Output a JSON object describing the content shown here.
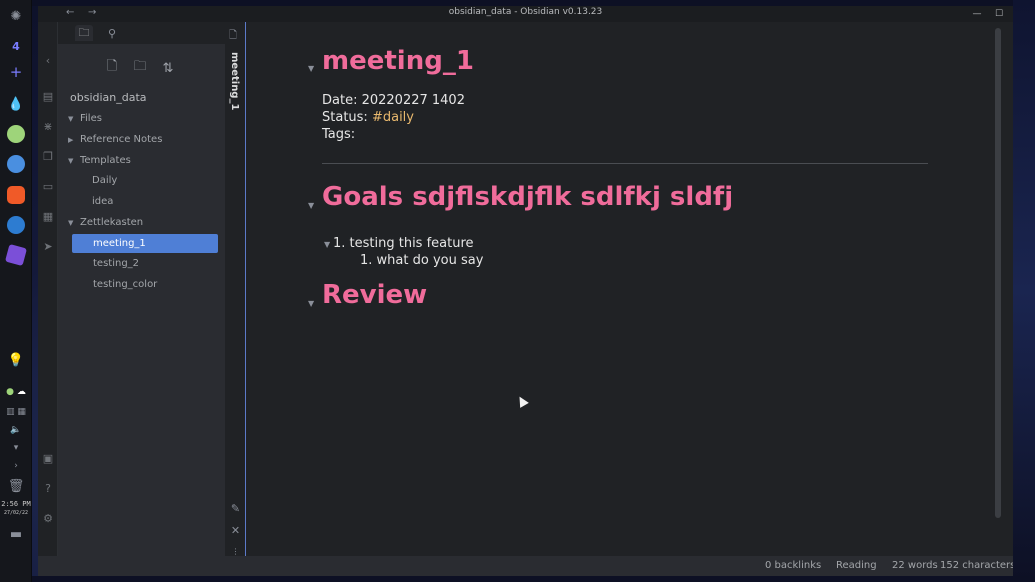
{
  "window": {
    "title": "obsidian_data - Obsidian v0.13.23",
    "back": "←",
    "forward": "→",
    "minimize": "—",
    "maximize": "☐",
    "close": "✕"
  },
  "os_panel": {
    "workspace": "4",
    "add": "+",
    "clock_time": "2:56 PM",
    "clock_date": "27/02/22"
  },
  "explorer": {
    "vault_name": "obsidian_data",
    "tree": [
      {
        "label": "Files",
        "caret": "▼",
        "level": 0
      },
      {
        "label": "Reference Notes",
        "caret": "▶",
        "level": 0
      },
      {
        "label": "Templates",
        "caret": "▼",
        "level": 0
      },
      {
        "label": "Daily",
        "caret": "",
        "level": 1
      },
      {
        "label": "idea",
        "caret": "",
        "level": 1
      },
      {
        "label": "Zettlekasten",
        "caret": "▼",
        "level": 0
      },
      {
        "label": "meeting_1",
        "caret": "",
        "level": 1,
        "selected": true
      },
      {
        "label": "testing_2",
        "caret": "",
        "level": 1
      },
      {
        "label": "testing_color",
        "caret": "",
        "level": 1
      }
    ]
  },
  "tab": {
    "label": "meeting_1"
  },
  "note": {
    "heading1": "meeting_1",
    "date": "Date: 20220227 1402",
    "status_label": "Status:",
    "status_tag": "#daily",
    "tags_label": "Tags:",
    "heading2": "Goals sdjflskdjflk sdlfkj sldfj",
    "list_item_1": "1. testing this feature",
    "list_item_2": "1. what do you say",
    "heading3": "Review"
  },
  "statusbar": {
    "backlinks": "0 backlinks",
    "mode": "Reading",
    "words": "22 words",
    "characters": "152 characters"
  },
  "colors": {
    "heading": "#f06c9b",
    "tag": "#e8b86d",
    "selection": "#4f7fd6",
    "background": "#202225"
  }
}
